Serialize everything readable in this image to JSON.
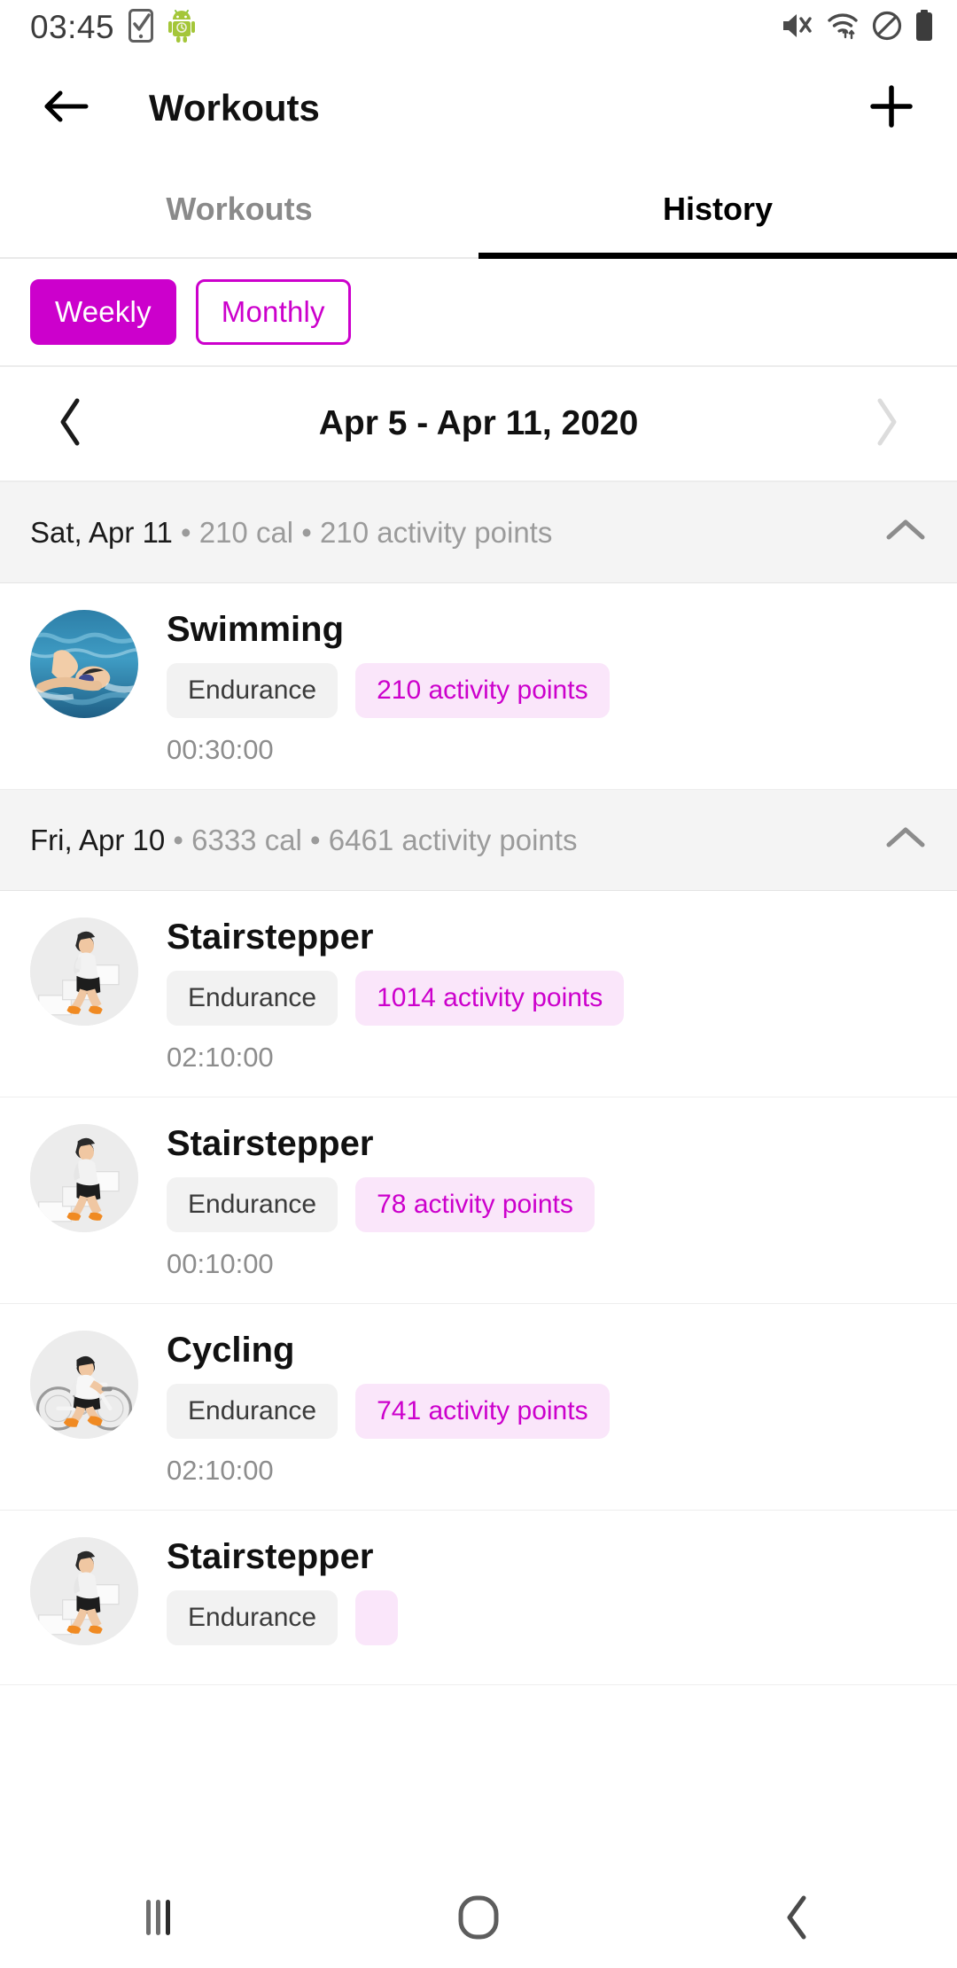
{
  "status_bar": {
    "time": "03:45",
    "left_icons": [
      "phone-check-icon",
      "android-robot-icon"
    ],
    "right_icons": [
      "mute-icon",
      "wifi-icon",
      "do-not-disturb-icon",
      "battery-icon"
    ]
  },
  "app_bar": {
    "back_icon": "back-arrow-icon",
    "title": "Workouts",
    "add_icon": "plus-icon"
  },
  "tabs": [
    {
      "label": "Workouts",
      "active": false
    },
    {
      "label": "History",
      "active": true
    }
  ],
  "filters": [
    {
      "label": "Weekly",
      "selected": true
    },
    {
      "label": "Monthly",
      "selected": false
    }
  ],
  "week_nav": {
    "prev_icon": "chevron-left-icon",
    "range": "Apr 5 - Apr 11, 2020",
    "next_icon": "chevron-right-icon",
    "prev_enabled": true,
    "next_enabled": false
  },
  "days": [
    {
      "date": "Sat, Apr 11",
      "separator": " • ",
      "calories": "210 cal",
      "points": "210 activity points",
      "collapse_icon": "chevron-up-icon",
      "workouts": [
        {
          "name": "Swimming",
          "avatar": "swimming-photo",
          "type": "Endurance",
          "points": "210 activity points",
          "duration": "00:30:00"
        }
      ]
    },
    {
      "date": "Fri, Apr 10",
      "separator": " • ",
      "calories": "6333 cal",
      "points": "6461 activity points",
      "collapse_icon": "chevron-up-icon",
      "workouts": [
        {
          "name": "Stairstepper",
          "avatar": "stairstepper-photo",
          "type": "Endurance",
          "points": "1014 activity points",
          "duration": "02:10:00"
        },
        {
          "name": "Stairstepper",
          "avatar": "stairstepper-photo",
          "type": "Endurance",
          "points": "78 activity points",
          "duration": "00:10:00"
        },
        {
          "name": "Cycling",
          "avatar": "cycling-photo",
          "type": "Endurance",
          "points": "741 activity points",
          "duration": "02:10:00"
        },
        {
          "name": "Stairstepper",
          "avatar": "stairstepper-photo",
          "type": "Endurance",
          "points": "",
          "duration": ""
        }
      ]
    }
  ],
  "nav_bar": {
    "recents_icon": "recents-icon",
    "home_icon": "home-circle-icon",
    "back_icon": "nav-back-icon"
  },
  "colors": {
    "accent": "#cc00cc",
    "accent_bg": "#fae6fa",
    "chip_bg": "#f2f2f2",
    "day_header_bg": "#f4f4f4",
    "muted_text": "#9b9b9b"
  }
}
